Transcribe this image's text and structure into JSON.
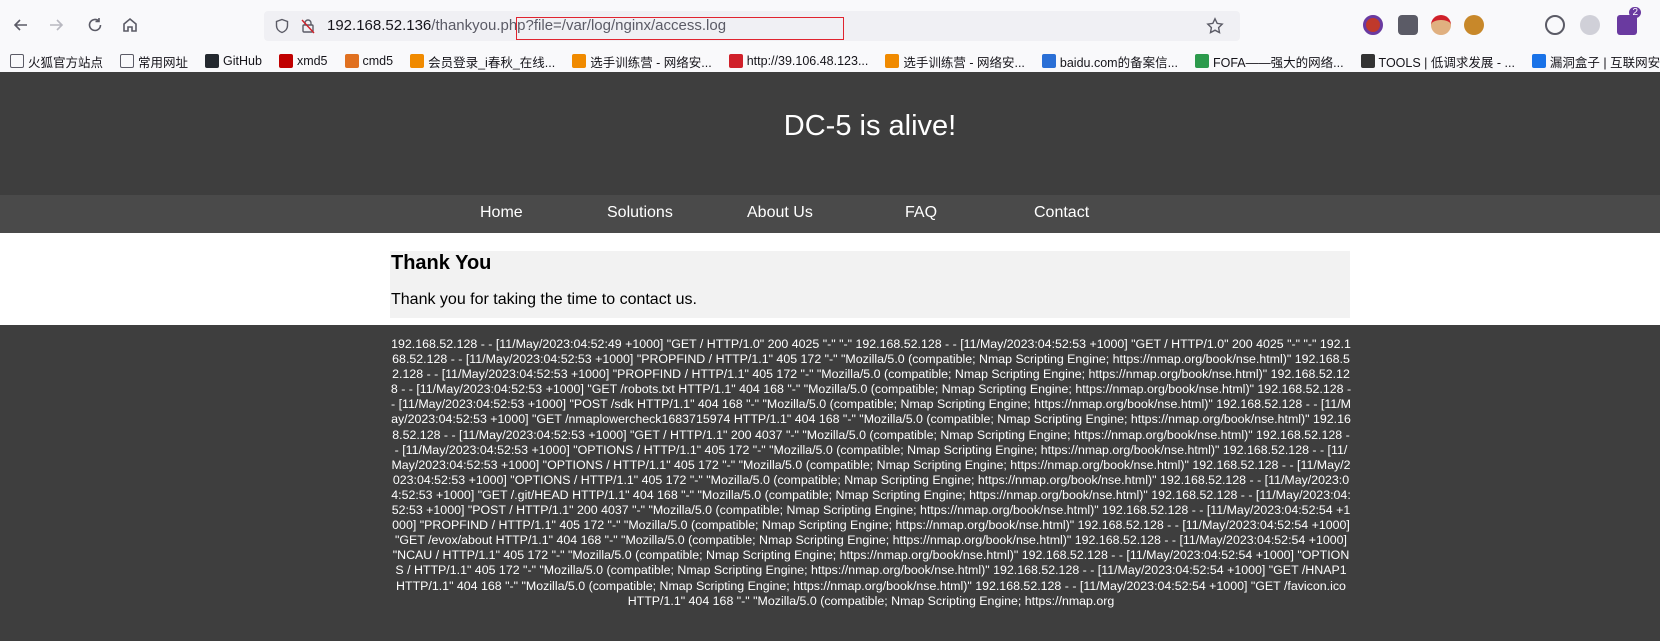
{
  "browser": {
    "url_host": "192.168.52.136",
    "url_path": "/thankyou.php?file=/var/log/nginx/access.log",
    "notification_badge": "2"
  },
  "bookmarks": [
    {
      "label": "火狐官方站点",
      "icon": "folder-icon",
      "color": "#5b5b66"
    },
    {
      "label": "常用网址",
      "icon": "folder-icon",
      "color": "#5b5b66"
    },
    {
      "label": "GitHub",
      "icon": "github-icon",
      "color": "#24292f"
    },
    {
      "label": "xmd5",
      "icon": "xmd5-icon",
      "color": "#c00000"
    },
    {
      "label": "cmd5",
      "icon": "cmd5-icon",
      "color": "#e07020"
    },
    {
      "label": "会员登录_i春秋_在线...",
      "icon": "ichunqiu-icon",
      "color": "#f08a00"
    },
    {
      "label": "选手训练营 - 网络安...",
      "icon": "ichunqiu-icon",
      "color": "#f08a00"
    },
    {
      "label": "http://39.106.48.123...",
      "icon": "z-icon",
      "color": "#d0202a"
    },
    {
      "label": "选手训练营 - 网络安...",
      "icon": "ichunqiu-icon",
      "color": "#f08a00"
    },
    {
      "label": "baidu.com的备案信...",
      "icon": "baidu-icon",
      "color": "#2a6fd6"
    },
    {
      "label": "FOFA——强大的网络...",
      "icon": "fofa-icon",
      "color": "#2c9a4c"
    },
    {
      "label": "TOOLS | 低调求发展 - ...",
      "icon": "tools-icon",
      "color": "#333333"
    },
    {
      "label": "漏洞盒子 | 互联网安...",
      "icon": "vulbox-icon",
      "color": "#1a73e8"
    }
  ],
  "site": {
    "title": "DC-5 is alive!",
    "nav": [
      "Home",
      "Solutions",
      "About Us",
      "FAQ",
      "Contact"
    ],
    "heading": "Thank You",
    "message": "Thank you for taking the time to contact us.",
    "log": "192.168.52.128 - - [11/May/2023:04:52:49 +1000] \"GET / HTTP/1.0\" 200 4025 \"-\" \"-\" 192.168.52.128 - - [11/May/2023:04:52:53 +1000] \"GET / HTTP/1.0\" 200 4025 \"-\" \"-\" 192.168.52.128 - - [11/May/2023:04:52:53 +1000] \"PROPFIND / HTTP/1.1\" 405 172 \"-\" \"Mozilla/5.0 (compatible; Nmap Scripting Engine; https://nmap.org/book/nse.html)\" 192.168.52.128 - - [11/May/2023:04:52:53 +1000] \"PROPFIND / HTTP/1.1\" 405 172 \"-\" \"Mozilla/5.0 (compatible; Nmap Scripting Engine; https://nmap.org/book/nse.html)\" 192.168.52.128 - - [11/May/2023:04:52:53 +1000] \"GET /robots.txt HTTP/1.1\" 404 168 \"-\" \"Mozilla/5.0 (compatible; Nmap Scripting Engine; https://nmap.org/book/nse.html)\" 192.168.52.128 - - [11/May/2023:04:52:53 +1000] \"POST /sdk HTTP/1.1\" 404 168 \"-\" \"Mozilla/5.0 (compatible; Nmap Scripting Engine; https://nmap.org/book/nse.html)\" 192.168.52.128 - - [11/May/2023:04:52:53 +1000] \"GET /nmaplowercheck1683715974 HTTP/1.1\" 404 168 \"-\" \"Mozilla/5.0 (compatible; Nmap Scripting Engine; https://nmap.org/book/nse.html)\" 192.168.52.128 - - [11/May/2023:04:52:53 +1000] \"GET / HTTP/1.1\" 200 4037 \"-\" \"Mozilla/5.0 (compatible; Nmap Scripting Engine; https://nmap.org/book/nse.html)\" 192.168.52.128 - - [11/May/2023:04:52:53 +1000] \"OPTIONS / HTTP/1.1\" 405 172 \"-\" \"Mozilla/5.0 (compatible; Nmap Scripting Engine; https://nmap.org/book/nse.html)\" 192.168.52.128 - - [11/May/2023:04:52:53 +1000] \"OPTIONS / HTTP/1.1\" 405 172 \"-\" \"Mozilla/5.0 (compatible; Nmap Scripting Engine; https://nmap.org/book/nse.html)\" 192.168.52.128 - - [11/May/2023:04:52:53 +1000] \"OPTIONS / HTTP/1.1\" 405 172 \"-\" \"Mozilla/5.0 (compatible; Nmap Scripting Engine; https://nmap.org/book/nse.html)\" 192.168.52.128 - - [11/May/2023:04:52:53 +1000] \"GET /.git/HEAD HTTP/1.1\" 404 168 \"-\" \"Mozilla/5.0 (compatible; Nmap Scripting Engine; https://nmap.org/book/nse.html)\" 192.168.52.128 - - [11/May/2023:04:52:53 +1000] \"POST / HTTP/1.1\" 200 4037 \"-\" \"Mozilla/5.0 (compatible; Nmap Scripting Engine; https://nmap.org/book/nse.html)\" 192.168.52.128 - - [11/May/2023:04:52:54 +1000] \"PROPFIND / HTTP/1.1\" 405 172 \"-\" \"Mozilla/5.0 (compatible; Nmap Scripting Engine; https://nmap.org/book/nse.html)\" 192.168.52.128 - - [11/May/2023:04:52:54 +1000] \"GET /evox/about HTTP/1.1\" 404 168 \"-\" \"Mozilla/5.0 (compatible; Nmap Scripting Engine; https://nmap.org/book/nse.html)\" 192.168.52.128 - - [11/May/2023:04:52:54 +1000] \"NCAU / HTTP/1.1\" 405 172 \"-\" \"Mozilla/5.0 (compatible; Nmap Scripting Engine; https://nmap.org/book/nse.html)\" 192.168.52.128 - - [11/May/2023:04:52:54 +1000] \"OPTIONS / HTTP/1.1\" 405 172 \"-\" \"Mozilla/5.0 (compatible; Nmap Scripting Engine; https://nmap.org/book/nse.html)\" 192.168.52.128 - - [11/May/2023:04:52:54 +1000] \"GET /HNAP1 HTTP/1.1\" 404 168 \"-\" \"Mozilla/5.0 (compatible; Nmap Scripting Engine; https://nmap.org/book/nse.html)\" 192.168.52.128 - - [11/May/2023:04:52:54 +1000] \"GET /favicon.ico HTTP/1.1\" 404 168 \"-\" \"Mozilla/5.0 (compatible; Nmap Scripting Engine; https://nmap.org"
  },
  "colors": {
    "header_bg": "#3e3e3e",
    "nav_bg": "#4a4a4a",
    "content_bg": "#f2f2f2",
    "url_highlight": "#e0242f"
  }
}
